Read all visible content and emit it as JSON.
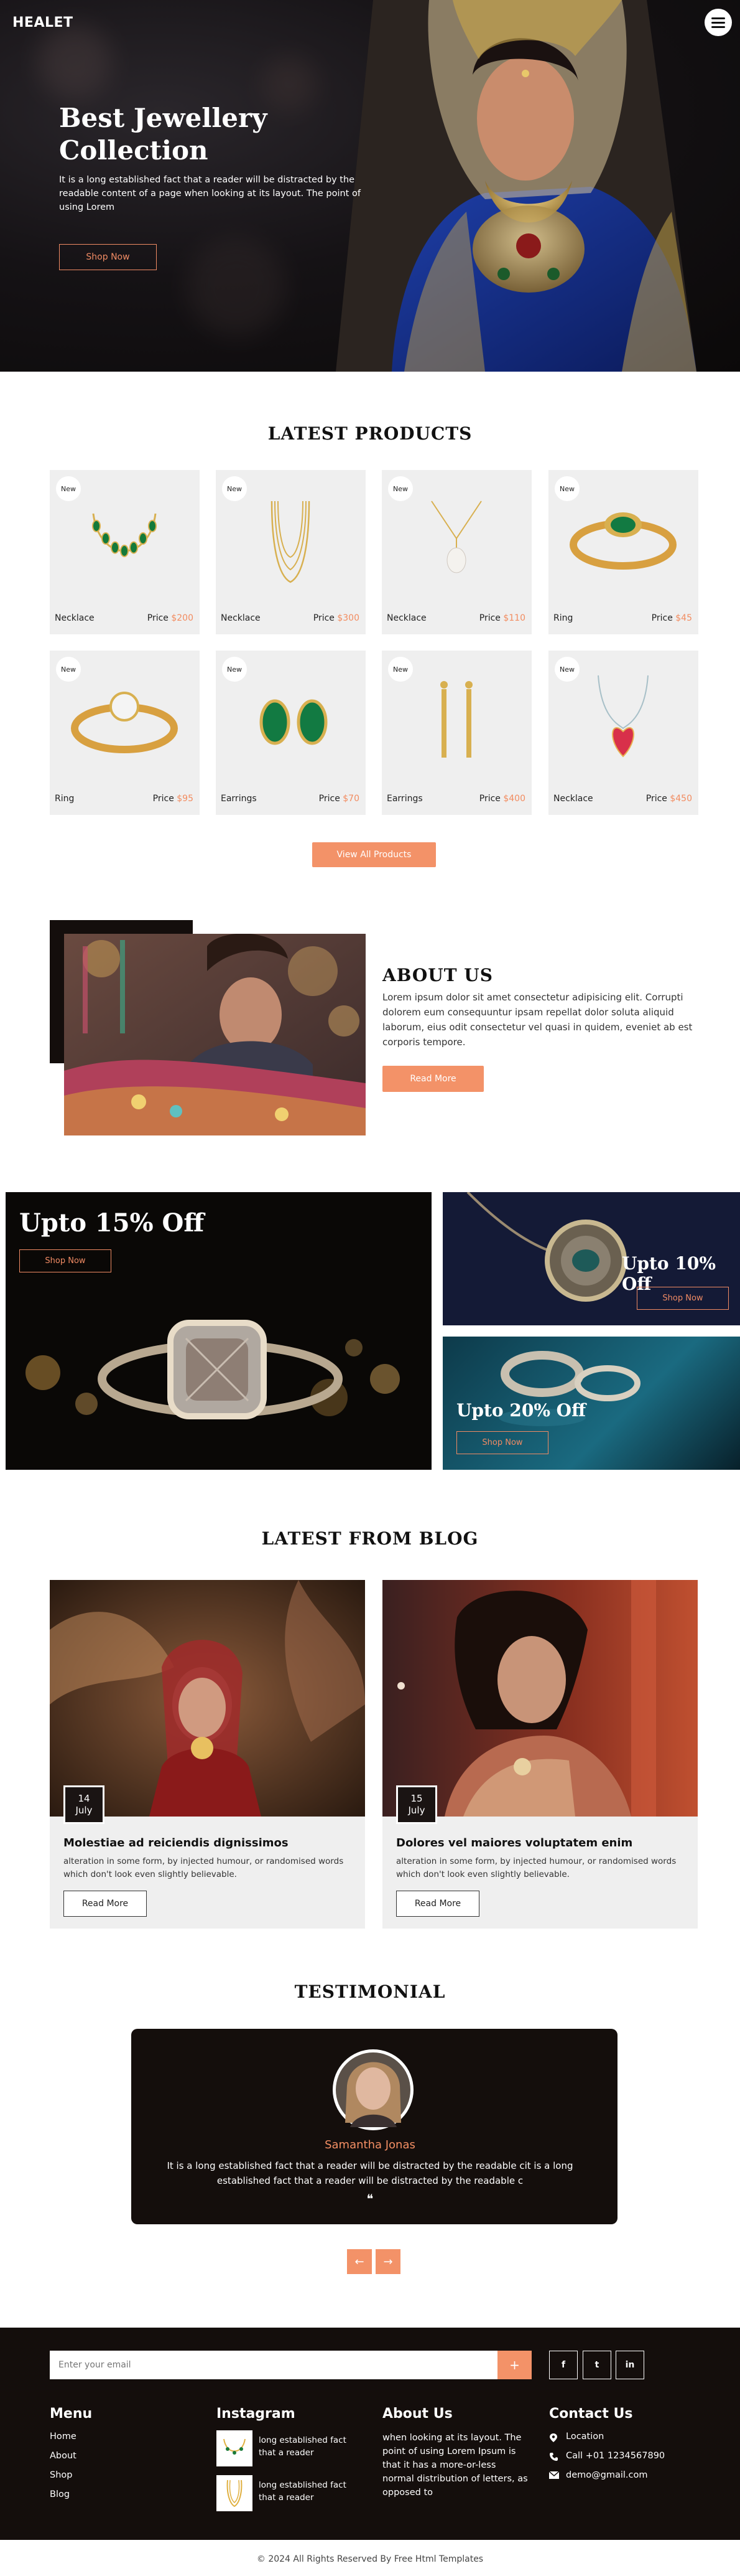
{
  "header": {
    "logo": "HEALET",
    "menu_icon": "hamburger-icon"
  },
  "hero": {
    "title_line1": "Best Jewellery",
    "title_line2": "Collection",
    "text": "It is a long established fact that a reader will be distracted by the readable content of a page when looking at its layout. The point of using Lorem",
    "button": "Shop Now"
  },
  "products": {
    "title": "LATEST PRODUCTS",
    "badge": "New",
    "price_label": "Price",
    "items": [
      {
        "name": "Necklace",
        "price": "$200"
      },
      {
        "name": "Necklace",
        "price": "$300"
      },
      {
        "name": "Necklace",
        "price": "$110"
      },
      {
        "name": "Ring",
        "price": "$45"
      },
      {
        "name": "Ring",
        "price": "$95"
      },
      {
        "name": "Earrings",
        "price": "$70"
      },
      {
        "name": "Earrings",
        "price": "$400"
      },
      {
        "name": "Necklace",
        "price": "$450"
      }
    ],
    "view_all": "View All Products"
  },
  "about": {
    "title": "ABOUT US",
    "text": "Lorem ipsum dolor sit amet consectetur adipisicing elit. Corrupti dolorem eum consequuntur ipsam repellat dolor soluta aliquid laborum, eius odit consectetur vel quasi in quidem, eveniet ab est corporis tempore.",
    "button": "Read More"
  },
  "promos": [
    {
      "title": "Upto 15% Off",
      "button": "Shop Now"
    },
    {
      "title": "Upto 10% Off",
      "button": "Shop Now"
    },
    {
      "title": "Upto 20% Off",
      "button": "Shop Now"
    }
  ],
  "blog": {
    "title": "LATEST FROM BLOG",
    "posts": [
      {
        "day": "14",
        "month": "July",
        "title": "Molestiae ad reiciendis dignissimos",
        "text": "alteration in some form, by injected humour, or randomised words which don't look even slightly believable.",
        "button": "Read More"
      },
      {
        "day": "15",
        "month": "July",
        "title": "Dolores vel maiores voluptatem enim",
        "text": "alteration in some form, by injected humour, or randomised words which don't look even slightly believable.",
        "button": "Read More"
      }
    ]
  },
  "testimonial": {
    "title": "TESTIMONIAL",
    "name": "Samantha Jonas",
    "text": "It is a long established fact that a reader will be distracted by the readable cit is a long established fact that a reader will be distracted by the readable c",
    "quote": "❝",
    "prev": "←",
    "next": "→"
  },
  "footer": {
    "email_placeholder": "Enter your email",
    "submit": "+",
    "social": [
      "f",
      "t",
      "in"
    ],
    "menu_title": "Menu",
    "menu": [
      "Home",
      "About",
      "Shop",
      "Blog"
    ],
    "instagram_title": "Instagram",
    "instagram_posts": [
      "long established fact that a reader",
      "long established fact that a reader"
    ],
    "about_title": "About Us",
    "about_text": "when looking at its layout. The point of using Lorem Ipsum is that it has a more-or-less normal distribution of letters, as opposed to",
    "contact_title": "Contact Us",
    "location": "Location",
    "phone": "Call +01 1234567890",
    "email": "demo@gmail.com",
    "copyright": "© 2024 All Rights Reserved By Free Html Templates"
  },
  "colors": {
    "accent": "#f39268",
    "dark": "#140e0c",
    "card": "#efefef"
  }
}
